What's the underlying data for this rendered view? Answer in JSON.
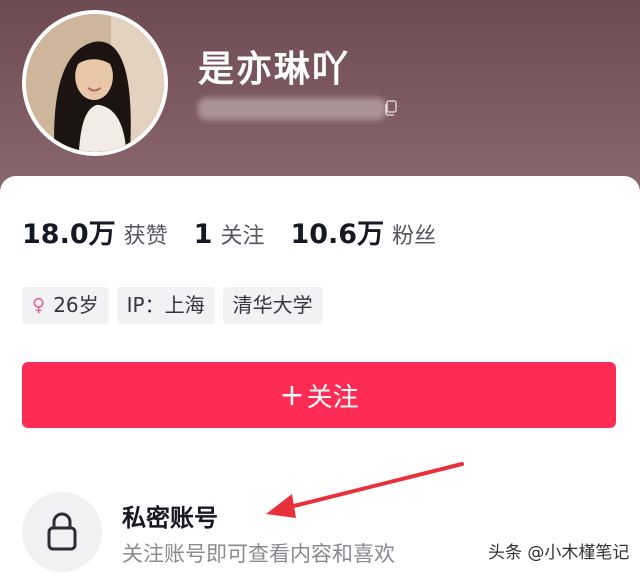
{
  "profile": {
    "username": "是亦琳吖",
    "avatar_alt": "profile-photo"
  },
  "stats": [
    {
      "value": "18.0万",
      "label": "获赞"
    },
    {
      "value": "1",
      "label": "关注"
    },
    {
      "value": "10.6万",
      "label": "粉丝"
    }
  ],
  "tags": [
    {
      "icon": "female-icon",
      "icon_glyph": "♀",
      "text": "26岁"
    },
    {
      "text": "IP：上海"
    },
    {
      "text": "清华大学"
    }
  ],
  "follow_button": {
    "plus": "+",
    "label": "关注"
  },
  "private": {
    "title": "私密账号",
    "subtitle": "关注账号即可查看内容和喜欢"
  },
  "watermark": "头条 @小木槿笔记",
  "colors": {
    "accent": "#fe2c55",
    "header": "#7e5a62",
    "annotation_arrow": "#e8313a"
  }
}
